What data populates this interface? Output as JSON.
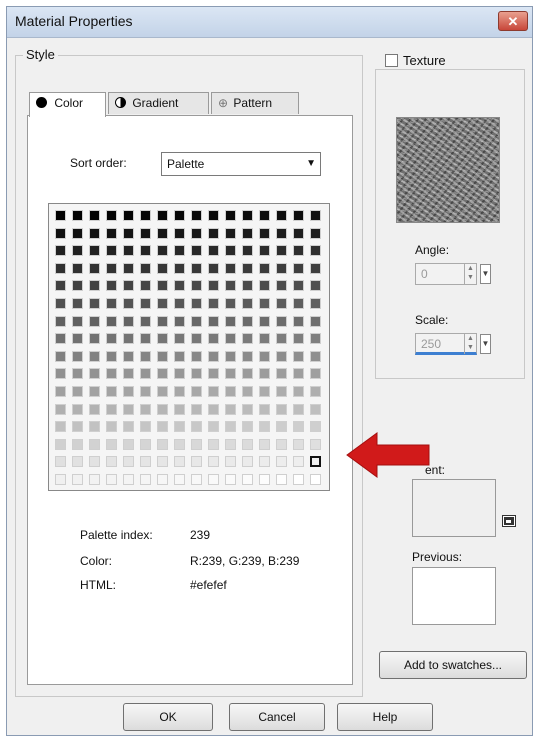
{
  "window": {
    "title": "Material Properties",
    "close_label": "✕"
  },
  "style_group": {
    "label": "Style"
  },
  "tabs": [
    {
      "label": "Color",
      "icon": "filled-circle-icon"
    },
    {
      "label": "Gradient",
      "icon": "half-circle-icon"
    },
    {
      "label": "Pattern",
      "icon": "crosshair-icon"
    }
  ],
  "sort": {
    "label": "Sort order:",
    "value": "Palette"
  },
  "palette": {
    "selected_index": 239,
    "rows": 16,
    "cols": 16
  },
  "info": {
    "index_label": "Palette index:",
    "index_value": "239",
    "color_label": "Color:",
    "color_value": "R:239, G:239, B:239",
    "html_label": "HTML:",
    "html_value": "#efefef"
  },
  "texture": {
    "checkbox_label": "Texture",
    "angle_label": "Angle:",
    "angle_value": "0",
    "scale_label": "Scale:",
    "scale_value": "250"
  },
  "current": {
    "label_visible": "ent:"
  },
  "previous": {
    "label": "Previous:"
  },
  "add_swatches_label": "Add to swatches...",
  "buttons": {
    "ok": "OK",
    "cancel": "Cancel",
    "help": "Help"
  },
  "colors": {
    "accent": "#3d7fd1",
    "annotation_arrow": "#d11a1a"
  }
}
